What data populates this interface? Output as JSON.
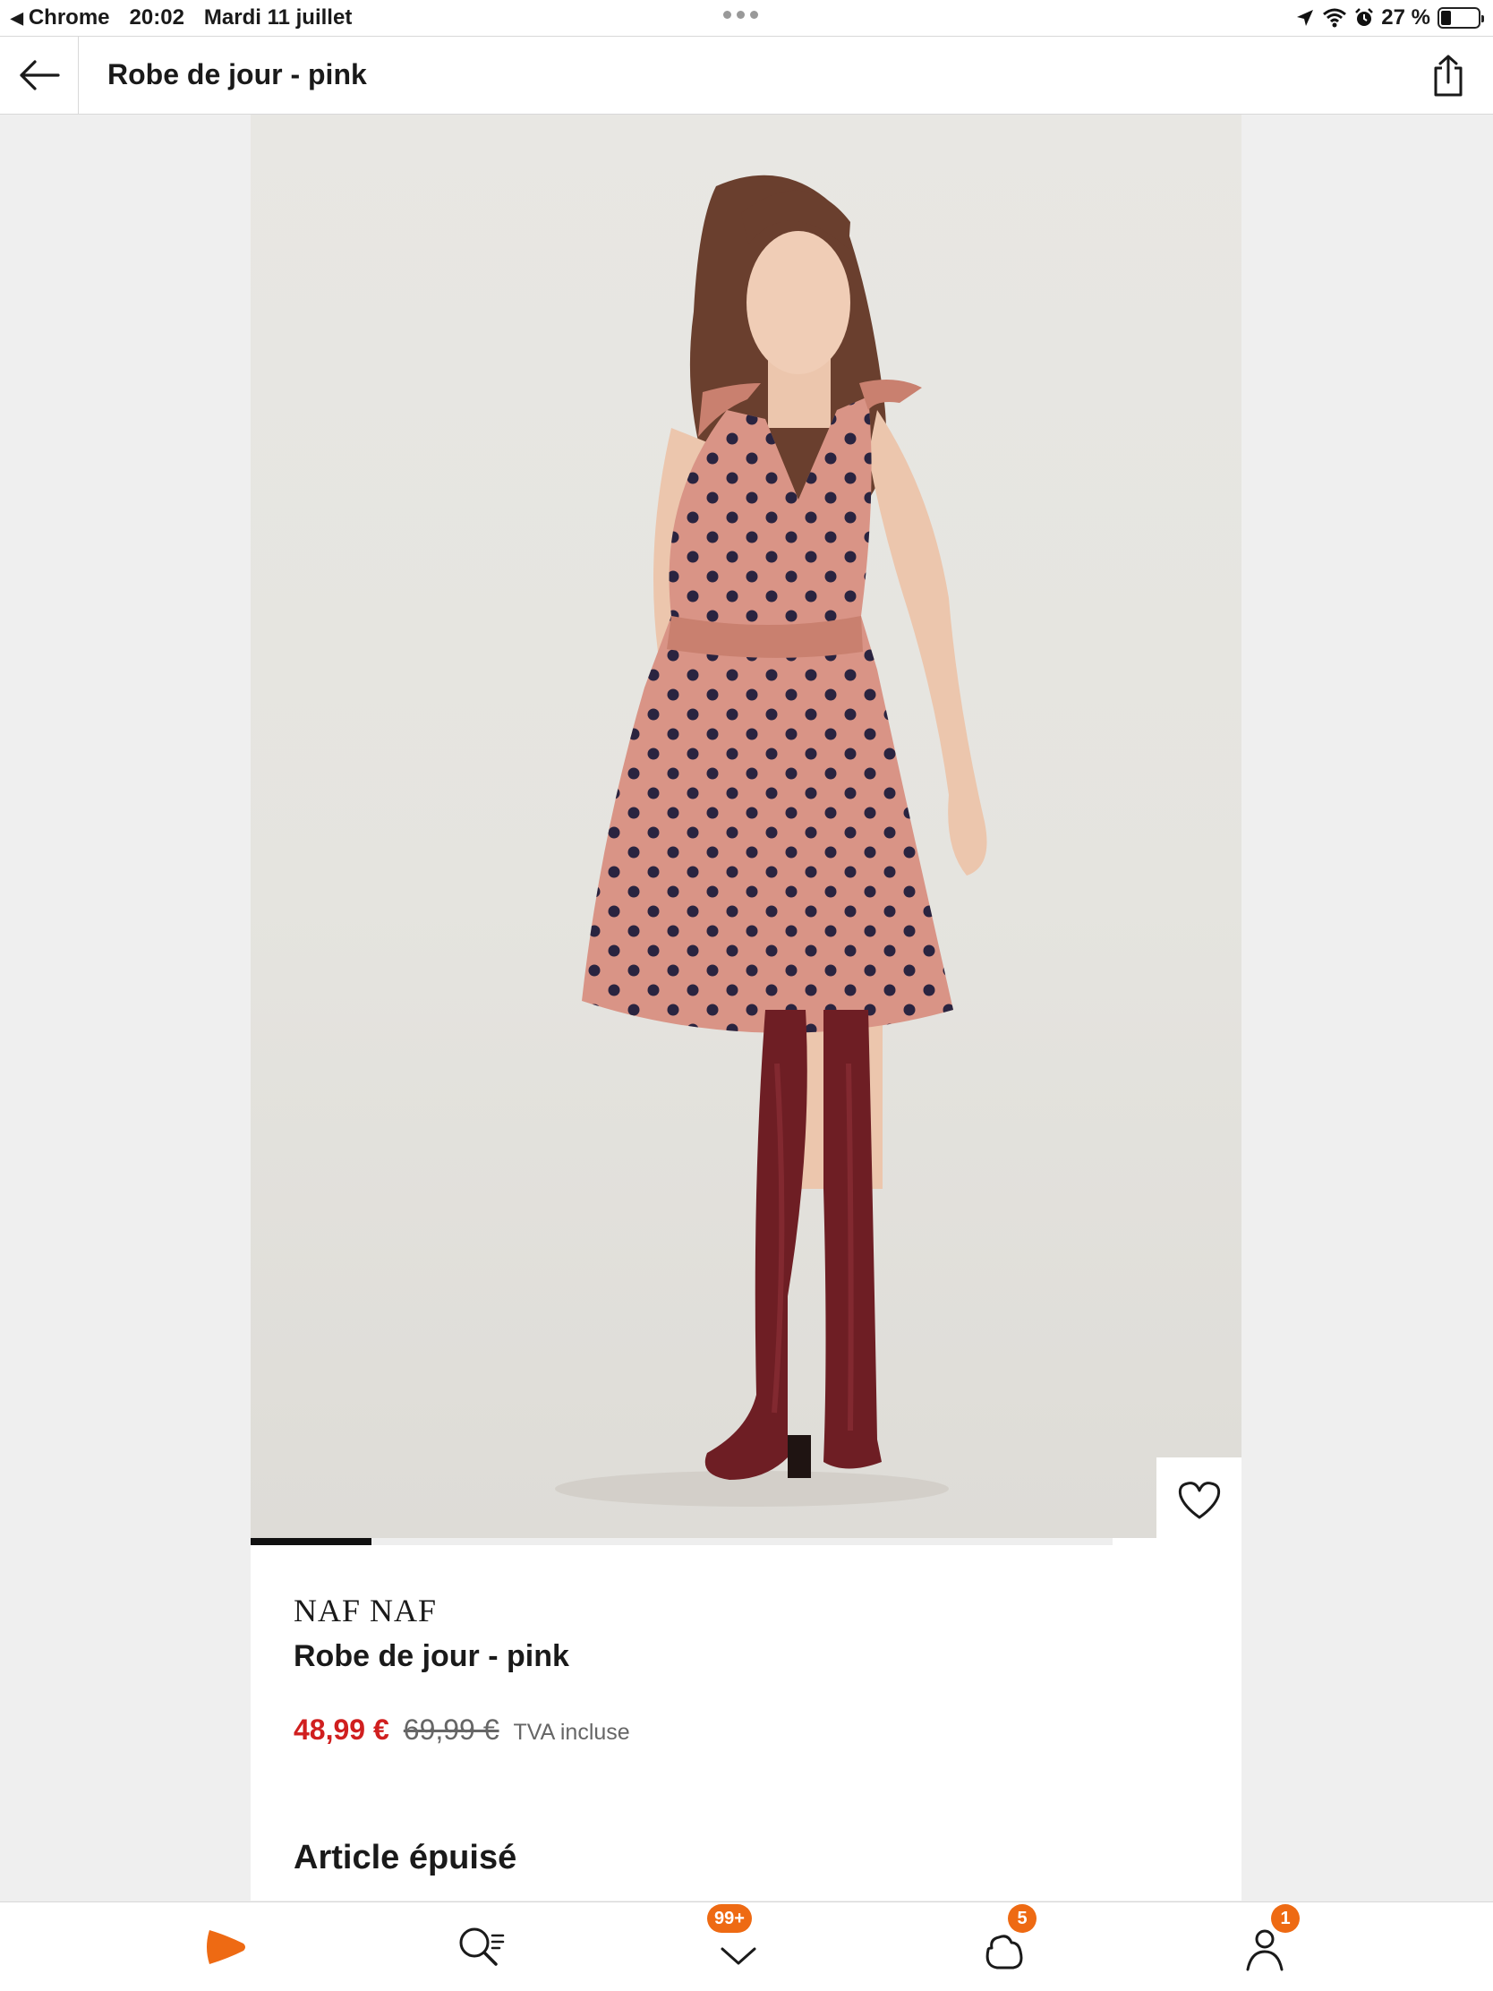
{
  "status_bar": {
    "app": "Chrome",
    "time": "20:02",
    "date": "Mardi 11 juillet",
    "battery": "27 %",
    "battery_level": 0.27
  },
  "header": {
    "title": "Robe de jour - pink"
  },
  "gallery": {
    "progress": 0.14
  },
  "product": {
    "brand": "NAF NAF",
    "name": "Robe de jour - pink",
    "price_current": "48,99 €",
    "price_old": "69,99 €",
    "tax_note": "TVA incluse",
    "stock_status": "Article épuisé"
  },
  "tabbar": {
    "wishlist_badge": "99+",
    "bag_badge": "5",
    "account_badge": "1"
  },
  "colors": {
    "accent": "#ee6a13",
    "sale_price": "#d01f1f",
    "dress": "#d99486",
    "boots": "#6e1e24"
  },
  "icons": [
    "back-arrow-icon",
    "share-icon",
    "heart-icon",
    "zalando-logo-icon",
    "search-icon",
    "wishlist-icon",
    "bag-icon",
    "account-icon"
  ]
}
